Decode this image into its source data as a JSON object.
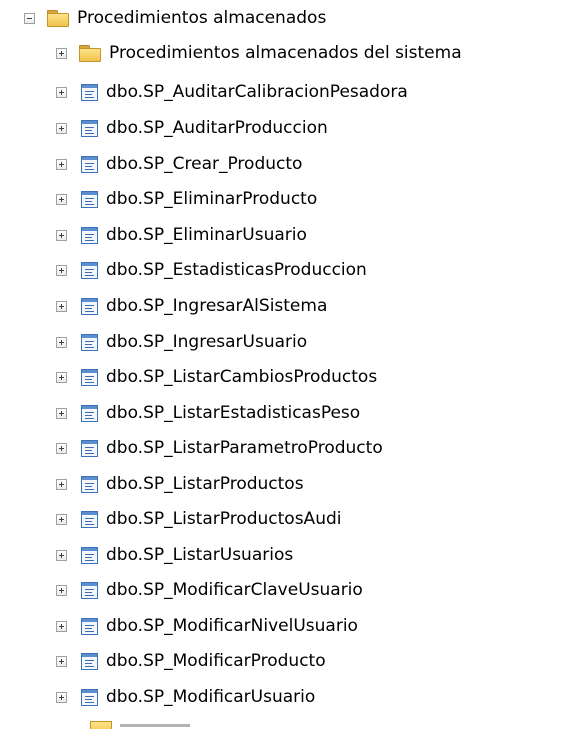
{
  "tree": {
    "root_label": "Procedimientos almacenados",
    "system_folder_label": "Procedimientos almacenados del sistema",
    "procedures": [
      "dbo.SP_AuditarCalibracionPesadora",
      "dbo.SP_AuditarProduccion",
      "dbo.SP_Crear_Producto",
      "dbo.SP_EliminarProducto",
      "dbo.SP_EliminarUsuario",
      "dbo.SP_EstadisticasProduccion",
      "dbo.SP_IngresarAlSistema",
      "dbo.SP_IngresarUsuario",
      "dbo.SP_ListarCambiosProductos",
      "dbo.SP_ListarEstadisticasPeso",
      "dbo.SP_ListarParametroProducto",
      "dbo.SP_ListarProductos",
      "dbo.SP_ListarProductosAudi",
      "dbo.SP_ListarUsuarios",
      "dbo.SP_ModificarClaveUsuario",
      "dbo.SP_ModificarNivelUsuario",
      "dbo.SP_ModificarProducto",
      "dbo.SP_ModificarUsuario"
    ]
  },
  "icons": {
    "expand": "plus-box-icon",
    "collapse": "minus-box-icon",
    "folder": "folder-icon",
    "procedure": "stored-procedure-icon"
  },
  "colors": {
    "folder_fill": "#f2c24c",
    "procedure_accent": "#3c73b8",
    "text": "#000000",
    "background": "#ffffff"
  }
}
